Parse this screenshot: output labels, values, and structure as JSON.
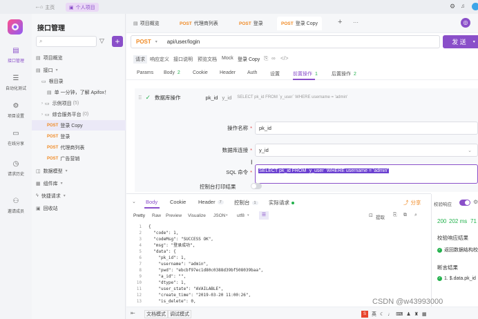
{
  "titlebar": {
    "tabs": [
      {
        "label": "主页"
      },
      {
        "label": "个人项目"
      }
    ]
  },
  "nav": {
    "items": [
      {
        "label": "接口管理"
      },
      {
        "label": "自动化测试"
      },
      {
        "label": "项目设置"
      },
      {
        "label": "在线分享"
      },
      {
        "label": "请求历史"
      },
      {
        "label": "邀请成员"
      }
    ]
  },
  "tree": {
    "title": "接口管理",
    "rows": [
      {
        "label": "项目概览"
      },
      {
        "label": "接口"
      },
      {
        "label": "根目录"
      },
      {
        "label": "单 一分钟，了解 Apifox！"
      },
      {
        "label": "示例项目",
        "count": "(5)"
      },
      {
        "label": "综合服务平台",
        "count": "(0)"
      },
      {
        "method": "POST",
        "label": "登录 Copy"
      },
      {
        "method": "POST",
        "label": "登录"
      },
      {
        "method": "POST",
        "label": "代理商列表"
      },
      {
        "method": "POST",
        "label": "广告营销"
      },
      {
        "label": "数据模型"
      },
      {
        "label": "组件库"
      },
      {
        "label": "快捷请求"
      },
      {
        "label": "回收站"
      }
    ]
  },
  "tabbar": {
    "tabs": [
      {
        "label": "项目概览"
      },
      {
        "method": "POST",
        "label": "代理商列表"
      },
      {
        "method": "POST",
        "label": "登录"
      },
      {
        "method": "POST",
        "label": "登录 Copy"
      }
    ],
    "plus": "+",
    "more": "···"
  },
  "request": {
    "method": "POST",
    "url": "api/user/login",
    "send_label": "发 送"
  },
  "subtabs": [
    "请求",
    "响应定义",
    "接口说明",
    "预览文档",
    "Mock",
    "登录 Copy"
  ],
  "param_tabs": [
    {
      "label": "Params"
    },
    {
      "label": "Body",
      "count": "2"
    },
    {
      "label": "Cookie"
    },
    {
      "label": "Header"
    },
    {
      "label": "Auth"
    },
    {
      "label": "设置"
    },
    {
      "label": "前置操作",
      "count": "1"
    },
    {
      "label": "后置操作",
      "count": "2"
    }
  ],
  "preop": {
    "name": "数据库操作",
    "summary_key": "pk_id",
    "summary_val": "y_id",
    "summary_sql": "SELECT pk_id FROM `y_user` WHERE username = 'admin'",
    "fields": {
      "op_name_label": "操作名称",
      "op_name_value": "pk_id",
      "db_label": "数据库连接",
      "db_value": "y_id",
      "sql_label": "SQL 命令",
      "sql_value": "SELECT pk_id FROM `y_user` WHERE username = 'admin'",
      "console_label": "控制台打印结果"
    }
  },
  "response": {
    "tabs": [
      {
        "label": "Body"
      },
      {
        "label": "Cookie"
      },
      {
        "label": "Header",
        "count": "7"
      },
      {
        "label": "控制台",
        "count": "1"
      },
      {
        "label": "实际请求"
      }
    ],
    "share": "分享",
    "format_tabs": [
      "Pretty",
      "Raw",
      "Preview",
      "Visualize",
      "JSON",
      "utf8"
    ],
    "extract": "提取",
    "code": [
      "{",
      "  \"code\": 1,",
      "  \"codeMsg\": \"SUCCESS OK\",",
      "  \"msg\": \"登录成功\",",
      "  \"data\": {",
      "    \"pk_id\": 1,",
      "    \"username\": \"admin\",",
      "    \"pwd\": \"ebcbf97ec1d80c0388d39bf508039baa\",",
      "    \"a_id\": \"\",",
      "    \"dtype\": 1,",
      "    \"user_state\": \"AVAILABLE\",",
      "    \"create_time\": \"2019-03-20 11:00:26\",",
      "    \"is_delete\": 0,"
    ]
  },
  "right_panel": {
    "verify_label": "校验响应",
    "status": "200",
    "time": "202 ms",
    "size": "71",
    "verify_result_title": "校验响应结果",
    "verify_result_item": "返回数据结构校",
    "assert_title": "断言结果",
    "assert_item": "1. $.data.pk_id"
  },
  "footer": {
    "doc_mode": "文档模式",
    "debug_mode": "调试模式",
    "watermark": "CSDN @w43993000"
  },
  "colors": {
    "accent": "#8a4fc9",
    "post": "#f08a24",
    "success": "#22b14c",
    "highlight": "#6a3fd0"
  }
}
